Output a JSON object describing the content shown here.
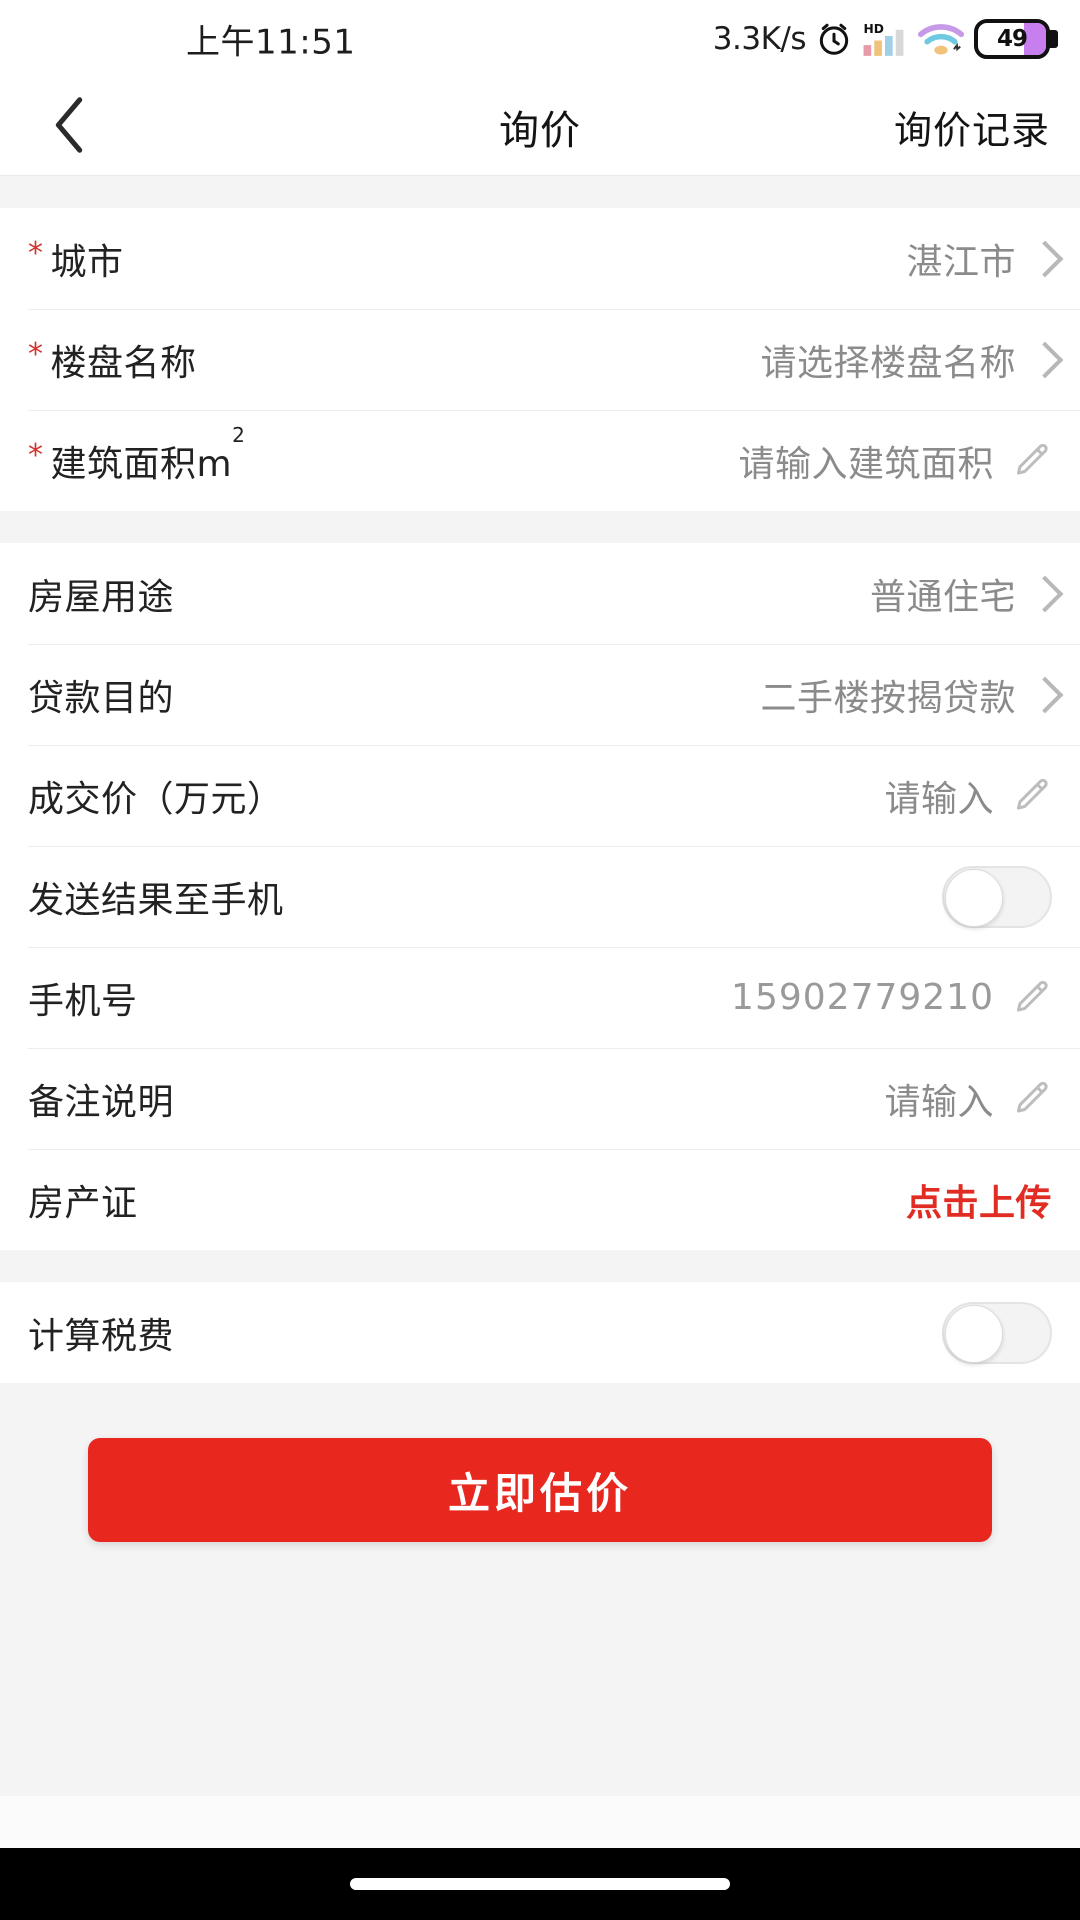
{
  "status_bar": {
    "time": "上午11:51",
    "network_speed": "3.3K/s",
    "alarm_icon": "alarm-clock-icon",
    "hd_label": "HD",
    "signal_icon": "cellular-signal-icon",
    "wifi_icon": "wifi-icon",
    "battery_level": "49"
  },
  "navbar": {
    "back_icon": "chevron-left-icon",
    "title": "询价",
    "action_label": "询价记录"
  },
  "form": {
    "group1": [
      {
        "label": "城市",
        "required": true,
        "value": "湛江市",
        "accessory": "chevron"
      },
      {
        "label": "楼盘名称",
        "required": true,
        "value": "请选择楼盘名称",
        "accessory": "chevron"
      },
      {
        "label": "建筑面积m",
        "label_sup": "2",
        "required": true,
        "value": "请输入建筑面积",
        "accessory": "pencil"
      }
    ],
    "group2": [
      {
        "label": "房屋用途",
        "required": false,
        "value": "普通住宅",
        "accessory": "chevron"
      },
      {
        "label": "贷款目的",
        "required": false,
        "value": "二手楼按揭贷款",
        "accessory": "chevron"
      },
      {
        "label": "成交价（万元）",
        "required": false,
        "value": "请输入",
        "accessory": "pencil"
      },
      {
        "label": "发送结果至手机",
        "required": false,
        "value": "",
        "accessory": "toggle",
        "toggle_on": false
      },
      {
        "label": "手机号",
        "required": false,
        "value": "15902779210",
        "accessory": "pencil"
      },
      {
        "label": "备注说明",
        "required": false,
        "value": "请输入",
        "accessory": "pencil"
      },
      {
        "label": "房产证",
        "required": false,
        "value": "点击上传",
        "accessory": "none",
        "value_style": "red"
      }
    ],
    "group3": [
      {
        "label": "计算税费",
        "required": false,
        "value": "",
        "accessory": "toggle",
        "toggle_on": false
      }
    ]
  },
  "submit": {
    "label": "立即估价"
  },
  "colors": {
    "accent_red": "#e8271f",
    "required_star": "#d0342c",
    "label_text": "#222222",
    "value_text": "#8b8b8b",
    "page_background": "#f4f4f4",
    "card_background": "#ffffff",
    "battery_fill": "#c77ff0"
  }
}
